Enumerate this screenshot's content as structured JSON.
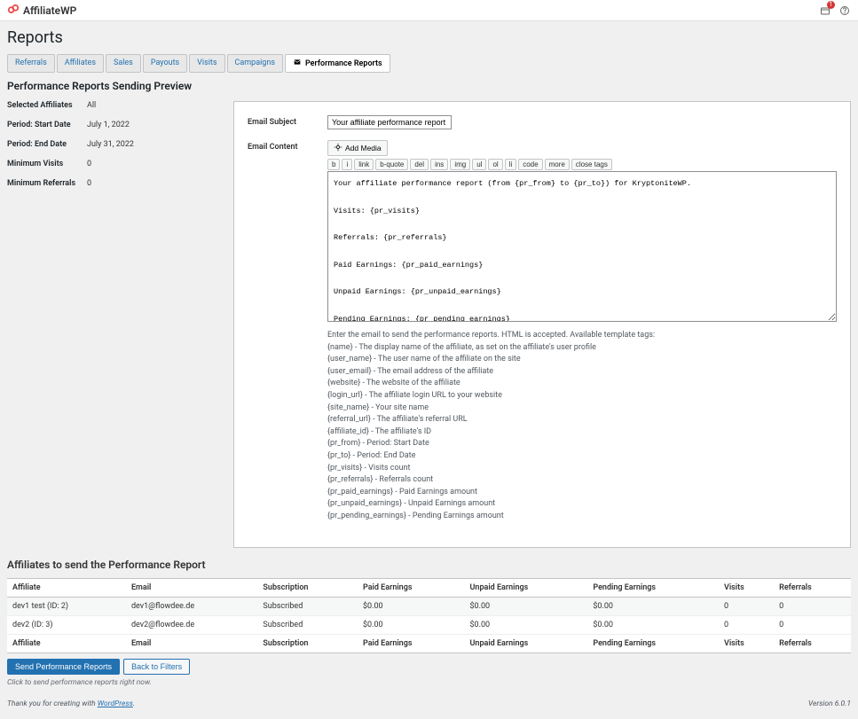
{
  "brand": {
    "name": "AffiliateWP"
  },
  "topbar": {
    "notif_count": "1"
  },
  "page_title": "Reports",
  "tabs": [
    {
      "label": "Referrals"
    },
    {
      "label": "Affiliates"
    },
    {
      "label": "Sales"
    },
    {
      "label": "Payouts"
    },
    {
      "label": "Visits"
    },
    {
      "label": "Campaigns"
    },
    {
      "label": "Performance Reports",
      "active": true
    }
  ],
  "section_title": "Performance Reports Sending Preview",
  "info": [
    {
      "label": "Selected Affiliates",
      "value": "All"
    },
    {
      "label": "Period: Start Date",
      "value": "July 1, 2022"
    },
    {
      "label": "Period: End Date",
      "value": "July 31, 2022"
    },
    {
      "label": "Minimum Visits",
      "value": "0"
    },
    {
      "label": "Minimum Referrals",
      "value": "0"
    }
  ],
  "form": {
    "subject_label": "Email Subject",
    "subject_value": "Your affiliate performance report",
    "content_label": "Email Content",
    "add_media": "Add Media",
    "editor_buttons": [
      "b",
      "i",
      "link",
      "b-quote",
      "del",
      "ins",
      "img",
      "ul",
      "ol",
      "li",
      "code",
      "more",
      "close tags"
    ],
    "body": "Your affiliate performance report (from {pr_from} to {pr_to}) for KryptoniteWP.\n\nVisits: {pr_visits}\n\nReferrals: {pr_referrals}\n\nPaid Earnings: {pr_paid_earnings}\n\nUnpaid Earnings: {pr_unpaid_earnings}\n\nPending Earnings: {pr_pending_earnings}",
    "help_intro": "Enter the email to send the performance reports. HTML is accepted. Available template tags:",
    "tags": [
      "{name} - The display name of the affiliate, as set on the affiliate's user profile",
      "{user_name} - The user name of the affiliate on the site",
      "{user_email} - The email address of the affiliate",
      "{website} - The website of the affiliate",
      "{login_url} - The affiliate login URL to your website",
      "{site_name} - Your site name",
      "{referral_url} - The affiliate's referral URL",
      "{affiliate_id} - The affiliate's ID",
      "{pr_from} - Period: Start Date",
      "{pr_to} - Period: End Date",
      "{pr_visits} - Visits count",
      "{pr_referrals} - Referrals count",
      "{pr_paid_earnings} - Paid Earnings amount",
      "{pr_unpaid_earnings} - Unpaid Earnings amount",
      "{pr_pending_earnings} - Pending Earnings amount"
    ]
  },
  "table": {
    "title": "Affiliates to send the Performance Report",
    "headers": [
      "Affiliate",
      "Email",
      "Subscription",
      "Paid Earnings",
      "Unpaid Earnings",
      "Pending Earnings",
      "Visits",
      "Referrals"
    ],
    "rows": [
      [
        "dev1 test (ID: 2)",
        "dev1@flowdee.de",
        "Subscribed",
        "$0.00",
        "$0.00",
        "$0.00",
        "0",
        "0"
      ],
      [
        "dev2 (ID: 3)",
        "dev2@flowdee.de",
        "Subscribed",
        "$0.00",
        "$0.00",
        "$0.00",
        "0",
        "0"
      ]
    ]
  },
  "actions": {
    "send": "Send Performance Reports",
    "back": "Back to Filters",
    "hint": "Click to send performance reports right now."
  },
  "footer": {
    "thanks_pre": "Thank you for creating with ",
    "thanks_link": "WordPress",
    "thanks_post": ".",
    "version": "Version 6.0.1"
  }
}
